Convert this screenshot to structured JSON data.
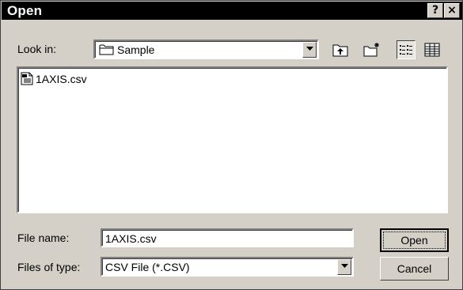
{
  "window": {
    "title": "Open",
    "help_glyph": "?",
    "close_glyph": "×"
  },
  "look_in": {
    "label": "Look in:",
    "value": "Sample",
    "folder_icon": "folder-icon"
  },
  "toolbar": {
    "up_icon": "up-one-level-icon",
    "new_folder_icon": "new-folder-icon",
    "list_icon": "list-view-icon",
    "details_icon": "details-view-icon"
  },
  "files": [
    {
      "name": "1AXIS.csv",
      "icon": "csv-file-icon"
    }
  ],
  "file_name": {
    "label": "File name:",
    "value": "1AXIS.csv"
  },
  "file_type": {
    "label": "Files of type:",
    "value": "CSV File (*.CSV)"
  },
  "buttons": {
    "open": "Open",
    "cancel": "Cancel"
  }
}
